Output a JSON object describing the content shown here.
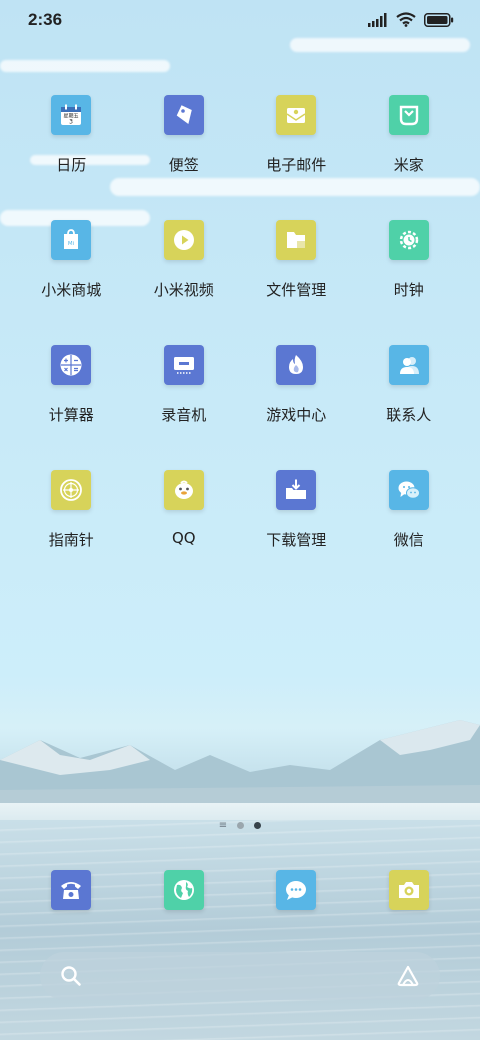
{
  "status_bar": {
    "time": "2:36",
    "signal_icon": "signal-icon",
    "wifi_icon": "wifi-icon",
    "battery_icon": "battery-icon"
  },
  "apps": [
    {
      "label": "日历",
      "icon": "calendar-icon",
      "color": "#58b6e6",
      "calendar_weekday": "星期五",
      "calendar_day": "3"
    },
    {
      "label": "便签",
      "icon": "notes-icon",
      "color": "#5b77d2"
    },
    {
      "label": "电子邮件",
      "icon": "email-icon",
      "color": "#d7d35a"
    },
    {
      "label": "米家",
      "icon": "mijia-icon",
      "color": "#4fd1a8"
    },
    {
      "label": "小米商城",
      "icon": "mi-store-icon",
      "color": "#58b6e6",
      "store_badge": "Mi"
    },
    {
      "label": "小米视频",
      "icon": "video-play-icon",
      "color": "#d7d35a"
    },
    {
      "label": "文件管理",
      "icon": "folder-icon",
      "color": "#d7d35a"
    },
    {
      "label": "时钟",
      "icon": "clock-icon",
      "color": "#4fd1a8"
    },
    {
      "label": "计算器",
      "icon": "calculator-icon",
      "color": "#5b77d2"
    },
    {
      "label": "录音机",
      "icon": "recorder-icon",
      "color": "#5b77d2"
    },
    {
      "label": "游戏中心",
      "icon": "game-center-icon",
      "color": "#5b77d2"
    },
    {
      "label": "联系人",
      "icon": "contacts-icon",
      "color": "#58b6e6"
    },
    {
      "label": "指南针",
      "icon": "compass-icon",
      "color": "#d7d35a"
    },
    {
      "label": "QQ",
      "icon": "qq-penguin-icon",
      "color": "#d7d35a"
    },
    {
      "label": "下载管理",
      "icon": "download-icon",
      "color": "#5b77d2"
    },
    {
      "label": "微信",
      "icon": "wechat-icon",
      "color": "#58b6e6"
    }
  ],
  "page_indicator": {
    "pages": 2,
    "current": 2
  },
  "dock": [
    {
      "icon": "phone-icon",
      "color": "#5b77d2"
    },
    {
      "icon": "browser-globe-icon",
      "color": "#4fd1a8"
    },
    {
      "icon": "messages-icon",
      "color": "#58b6e6"
    },
    {
      "icon": "camera-icon",
      "color": "#d7d35a"
    }
  ],
  "search_bar": {
    "left_icon": "search-icon",
    "right_icon": "assistant-icon"
  }
}
